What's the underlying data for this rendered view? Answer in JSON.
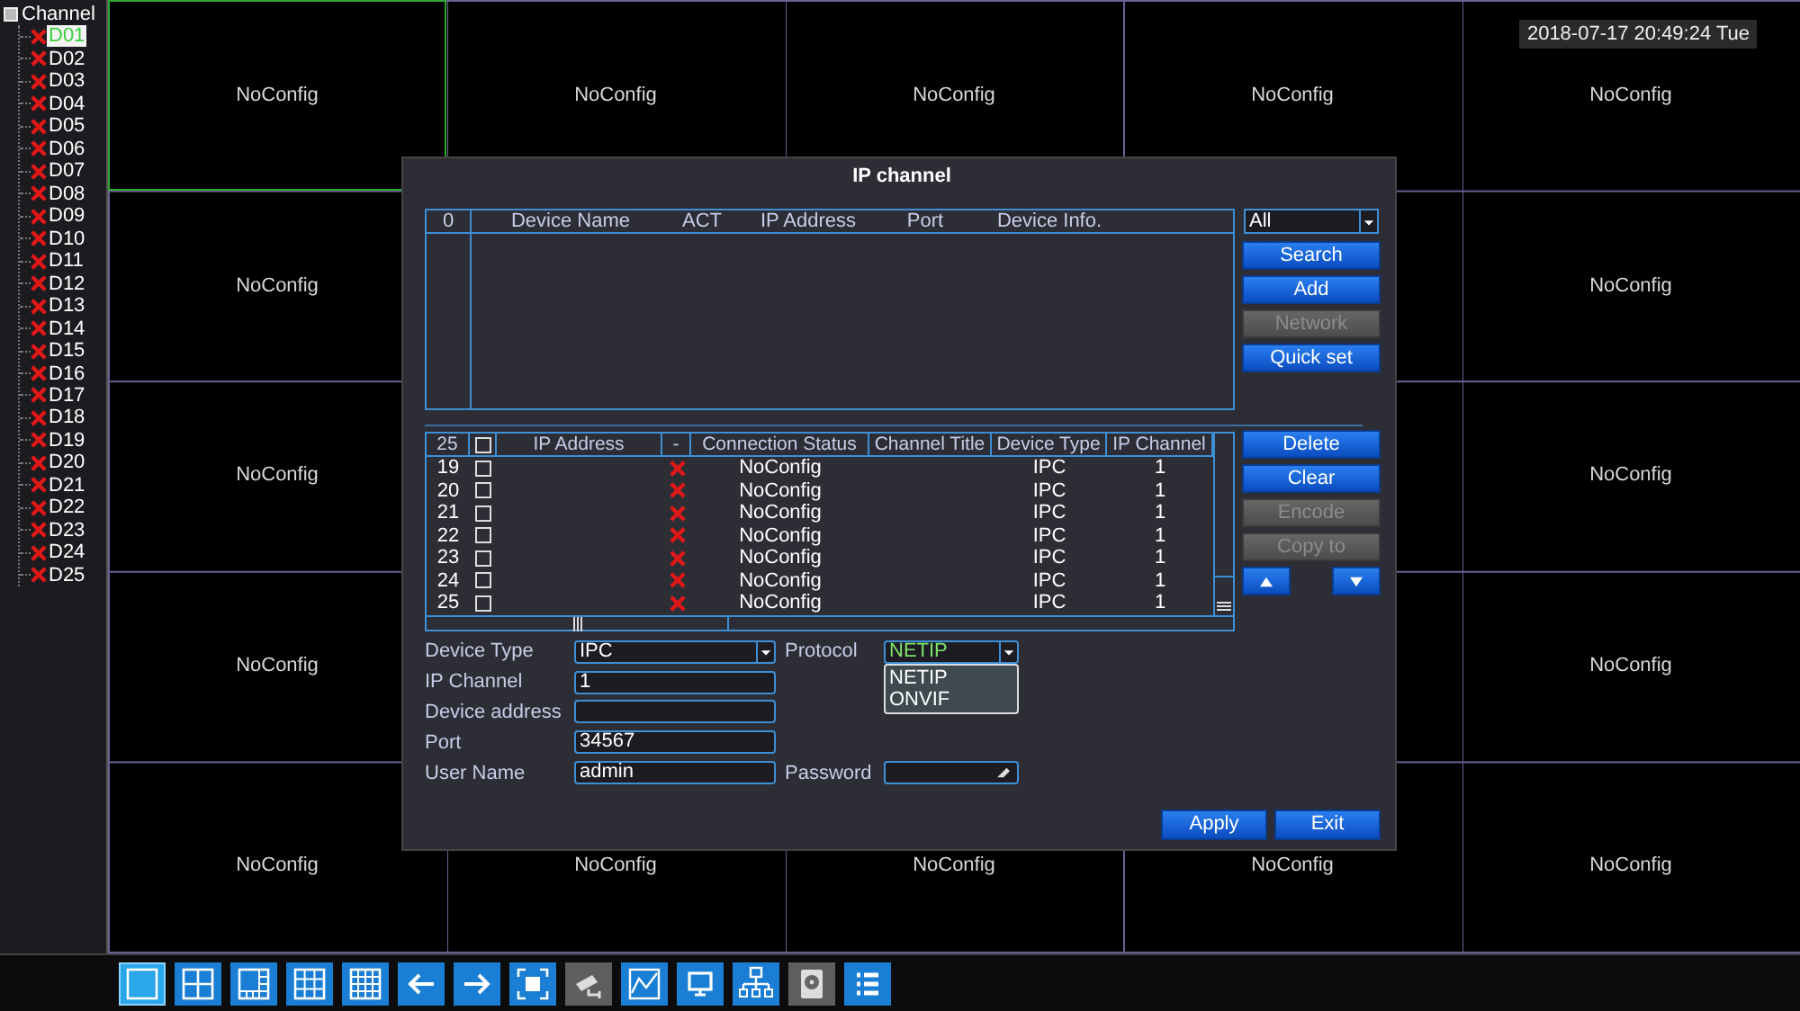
{
  "sidebar": {
    "title": "Channel",
    "items": [
      {
        "label": "D01",
        "selected": true,
        "connected": false
      },
      {
        "label": "D02",
        "selected": false,
        "connected": false
      },
      {
        "label": "D03",
        "selected": false,
        "connected": false
      },
      {
        "label": "D04",
        "selected": false,
        "connected": false
      },
      {
        "label": "D05",
        "selected": false,
        "connected": false
      },
      {
        "label": "D06",
        "selected": false,
        "connected": false
      },
      {
        "label": "D07",
        "selected": false,
        "connected": false
      },
      {
        "label": "D08",
        "selected": false,
        "connected": false
      },
      {
        "label": "D09",
        "selected": false,
        "connected": false
      },
      {
        "label": "D10",
        "selected": false,
        "connected": false
      },
      {
        "label": "D11",
        "selected": false,
        "connected": false
      },
      {
        "label": "D12",
        "selected": false,
        "connected": false
      },
      {
        "label": "D13",
        "selected": false,
        "connected": false
      },
      {
        "label": "D14",
        "selected": false,
        "connected": false
      },
      {
        "label": "D15",
        "selected": false,
        "connected": false
      },
      {
        "label": "D16",
        "selected": false,
        "connected": false
      },
      {
        "label": "D17",
        "selected": false,
        "connected": false
      },
      {
        "label": "D18",
        "selected": false,
        "connected": false
      },
      {
        "label": "D19",
        "selected": false,
        "connected": false
      },
      {
        "label": "D20",
        "selected": false,
        "connected": false
      },
      {
        "label": "D21",
        "selected": false,
        "connected": false
      },
      {
        "label": "D22",
        "selected": false,
        "connected": false
      },
      {
        "label": "D23",
        "selected": false,
        "connected": false
      },
      {
        "label": "D24",
        "selected": false,
        "connected": false
      },
      {
        "label": "D25",
        "selected": false,
        "connected": false
      }
    ]
  },
  "datetime": "2018-07-17 20:49:24 Tue",
  "tiles": [
    {
      "label": "NoConfig",
      "selected": true
    },
    {
      "label": "NoConfig",
      "selected": false
    },
    {
      "label": "NoConfig",
      "selected": false
    },
    {
      "label": "NoConfig",
      "selected": false
    },
    {
      "label": "NoConfig",
      "selected": false
    },
    {
      "label": "NoConfig",
      "selected": false
    },
    {
      "label": "NoConfig",
      "selected": false
    },
    {
      "label": "NoConfig",
      "selected": false
    },
    {
      "label": "NoConfig",
      "selected": false
    },
    {
      "label": "NoConfig",
      "selected": false
    },
    {
      "label": "NoConfig",
      "selected": false
    },
    {
      "label": "NoConfig",
      "selected": false
    },
    {
      "label": "NoConfig",
      "selected": false
    },
    {
      "label": "NoConfig",
      "selected": false
    },
    {
      "label": "NoConfig",
      "selected": false
    },
    {
      "label": "NoConfig",
      "selected": false
    }
  ],
  "dialog": {
    "title": "IP channel",
    "search_table": {
      "count": "0",
      "columns": [
        "Device Name",
        "ACT",
        "IP Address",
        "Port",
        "Device Info."
      ]
    },
    "filter": {
      "value": "All"
    },
    "search_buttons": [
      {
        "label": "Search",
        "disabled": false
      },
      {
        "label": "Add",
        "disabled": false
      },
      {
        "label": "Network",
        "disabled": true
      },
      {
        "label": "Quick set",
        "disabled": false
      }
    ],
    "channel_table": {
      "count": "25",
      "all_checked": false,
      "columns": [
        "IP Address",
        "-",
        "Connection Status",
        "Channel Title",
        "Device Type",
        "IP Channel"
      ],
      "rows": [
        {
          "number": "19",
          "checked": false,
          "connected": false,
          "status": "NoConfig",
          "device_type": "IPC",
          "ip_channel": "1"
        },
        {
          "number": "20",
          "checked": false,
          "connected": false,
          "status": "NoConfig",
          "device_type": "IPC",
          "ip_channel": "1"
        },
        {
          "number": "21",
          "checked": false,
          "connected": false,
          "status": "NoConfig",
          "device_type": "IPC",
          "ip_channel": "1"
        },
        {
          "number": "22",
          "checked": false,
          "connected": false,
          "status": "NoConfig",
          "device_type": "IPC",
          "ip_channel": "1"
        },
        {
          "number": "23",
          "checked": false,
          "connected": false,
          "status": "NoConfig",
          "device_type": "IPC",
          "ip_channel": "1"
        },
        {
          "number": "24",
          "checked": false,
          "connected": false,
          "status": "NoConfig",
          "device_type": "IPC",
          "ip_channel": "1"
        },
        {
          "number": "25",
          "checked": false,
          "connected": false,
          "status": "NoConfig",
          "device_type": "IPC",
          "ip_channel": "1"
        }
      ]
    },
    "channel_buttons": [
      {
        "label": "Delete",
        "disabled": false
      },
      {
        "label": "Clear",
        "disabled": false
      },
      {
        "label": "Encode",
        "disabled": true
      },
      {
        "label": "Copy to",
        "disabled": true
      }
    ],
    "form": {
      "fields": [
        {
          "label": "Device Type",
          "kind": "select",
          "value": "IPC"
        },
        {
          "label": "IP Channel",
          "kind": "text",
          "value": "1"
        },
        {
          "label": "Device address",
          "kind": "text"
        },
        {
          "label": "Port",
          "kind": "text",
          "value": "34567"
        },
        {
          "label": "User Name",
          "kind": "text",
          "value": "admin"
        }
      ],
      "protocol": {
        "label": "Protocol",
        "value": "NETIP",
        "expanded": true,
        "options": [
          "NETIP",
          "ONVIF"
        ]
      },
      "password": {
        "label": "Password"
      }
    },
    "buttons": [
      "Apply",
      "Exit"
    ]
  },
  "toolbar": [
    {
      "kind": "single",
      "selected": true,
      "disabled": false
    },
    {
      "kind": "quad",
      "selected": false,
      "disabled": false
    },
    {
      "kind": "split",
      "selected": false,
      "disabled": false
    },
    {
      "kind": "nine",
      "selected": false,
      "disabled": false
    },
    {
      "kind": "sixteen",
      "selected": false,
      "disabled": false
    },
    {
      "kind": "prev",
      "selected": false,
      "disabled": false
    },
    {
      "kind": "next",
      "selected": false,
      "disabled": false
    },
    {
      "kind": "full",
      "selected": false,
      "disabled": false
    },
    {
      "kind": "camera",
      "selected": false,
      "disabled": true
    },
    {
      "kind": "chart",
      "selected": false,
      "disabled": false
    },
    {
      "kind": "monitor",
      "selected": false,
      "disabled": false
    },
    {
      "kind": "network",
      "selected": false,
      "disabled": false
    },
    {
      "kind": "disk",
      "selected": false,
      "disabled": true
    },
    {
      "kind": "list",
      "selected": false,
      "disabled": false
    }
  ]
}
